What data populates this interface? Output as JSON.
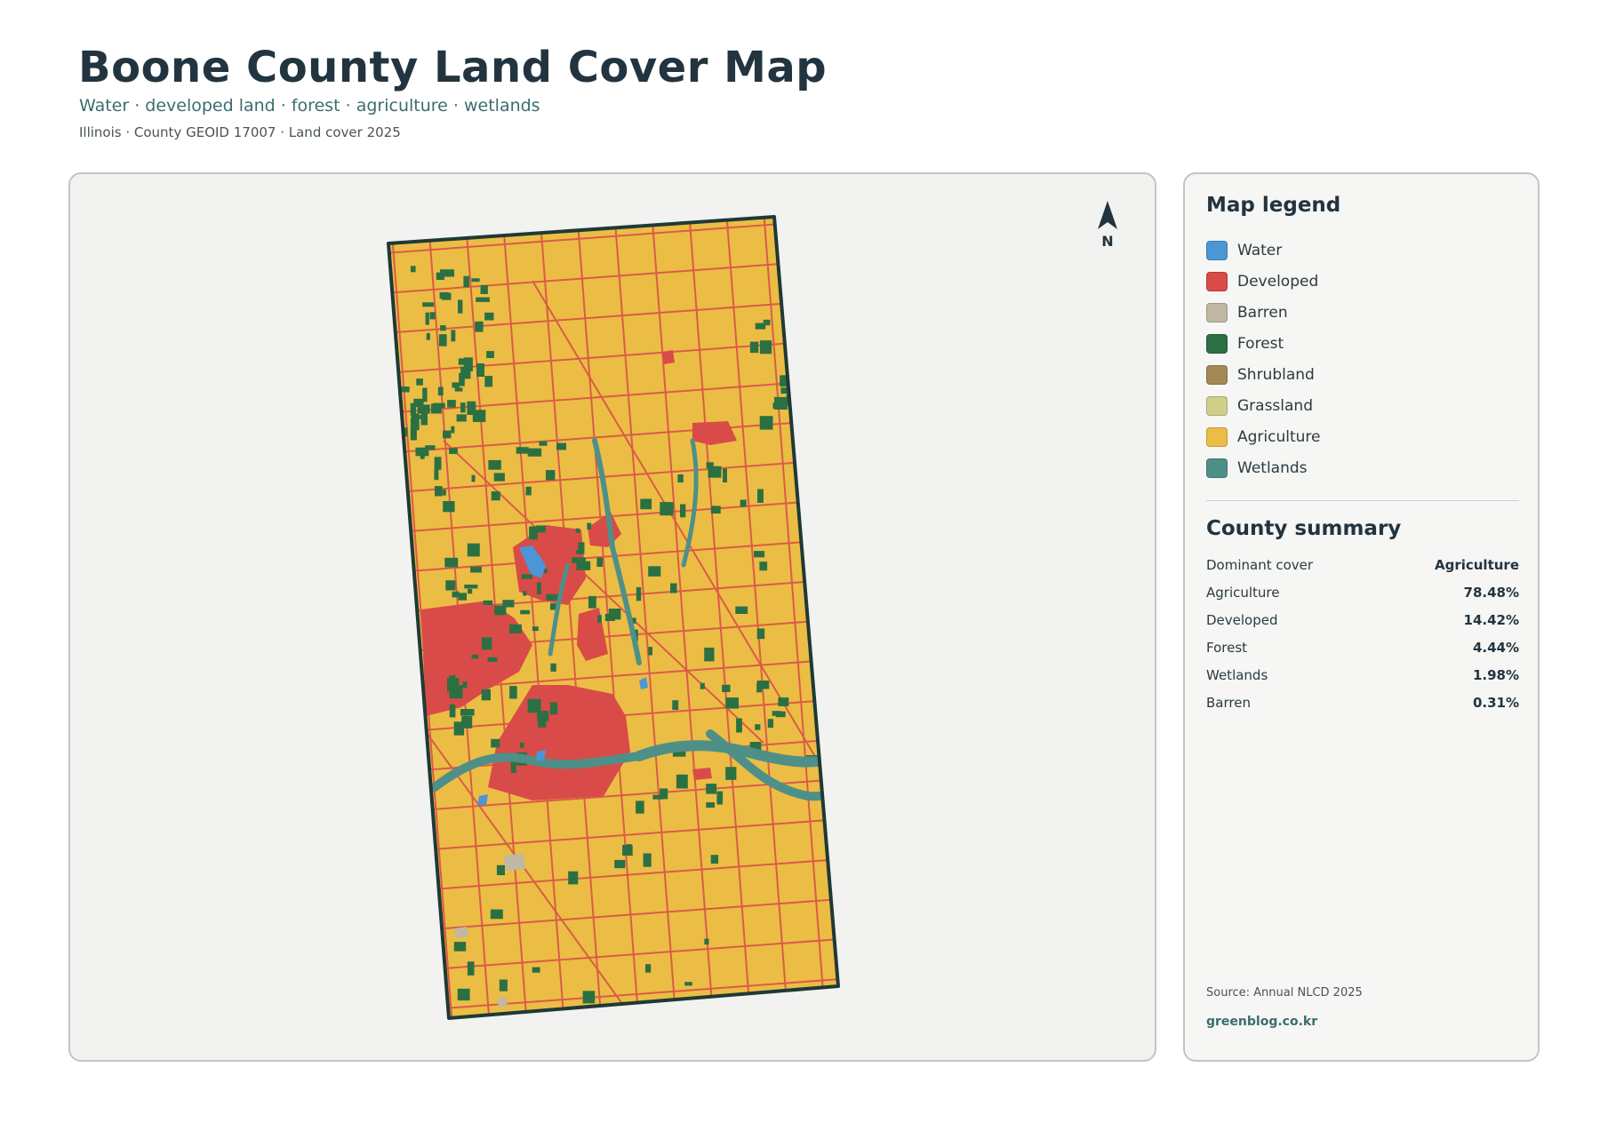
{
  "header": {
    "title": "Boone County Land Cover Map",
    "subtitle": "Water · developed land · forest · agriculture · wetlands",
    "meta": "Illinois · County GEOID 17007 · Land cover 2025"
  },
  "map": {
    "north_label": "N",
    "colors": {
      "agriculture": "#ebbd45",
      "developed": "#d94b48",
      "forest": "#2b7043",
      "wetlands": "#4e9088",
      "water": "#4b97d6",
      "barren": "#c0b8a2",
      "roads": "#d94b48",
      "outline": "#1e3a36"
    }
  },
  "legend": {
    "title": "Map legend",
    "items": [
      {
        "label": "Water",
        "color": "#4b97d6"
      },
      {
        "label": "Developed",
        "color": "#d94b48"
      },
      {
        "label": "Barren",
        "color": "#c0b8a2"
      },
      {
        "label": "Forest",
        "color": "#2b7043"
      },
      {
        "label": "Shrubland",
        "color": "#a48957"
      },
      {
        "label": "Grassland",
        "color": "#cfcf8a"
      },
      {
        "label": "Agriculture",
        "color": "#ebbd45"
      },
      {
        "label": "Wetlands",
        "color": "#4e9088"
      }
    ]
  },
  "summary": {
    "title": "County summary",
    "rows": [
      {
        "label": "Dominant cover",
        "value": "Agriculture"
      },
      {
        "label": "Agriculture",
        "value": "78.48%"
      },
      {
        "label": "Developed",
        "value": "14.42%"
      },
      {
        "label": "Forest",
        "value": "4.44%"
      },
      {
        "label": "Wetlands",
        "value": "1.98%"
      },
      {
        "label": "Barren",
        "value": "0.31%"
      }
    ],
    "source": "Source: Annual NLCD 2025",
    "site": "greenblog.co.kr"
  }
}
